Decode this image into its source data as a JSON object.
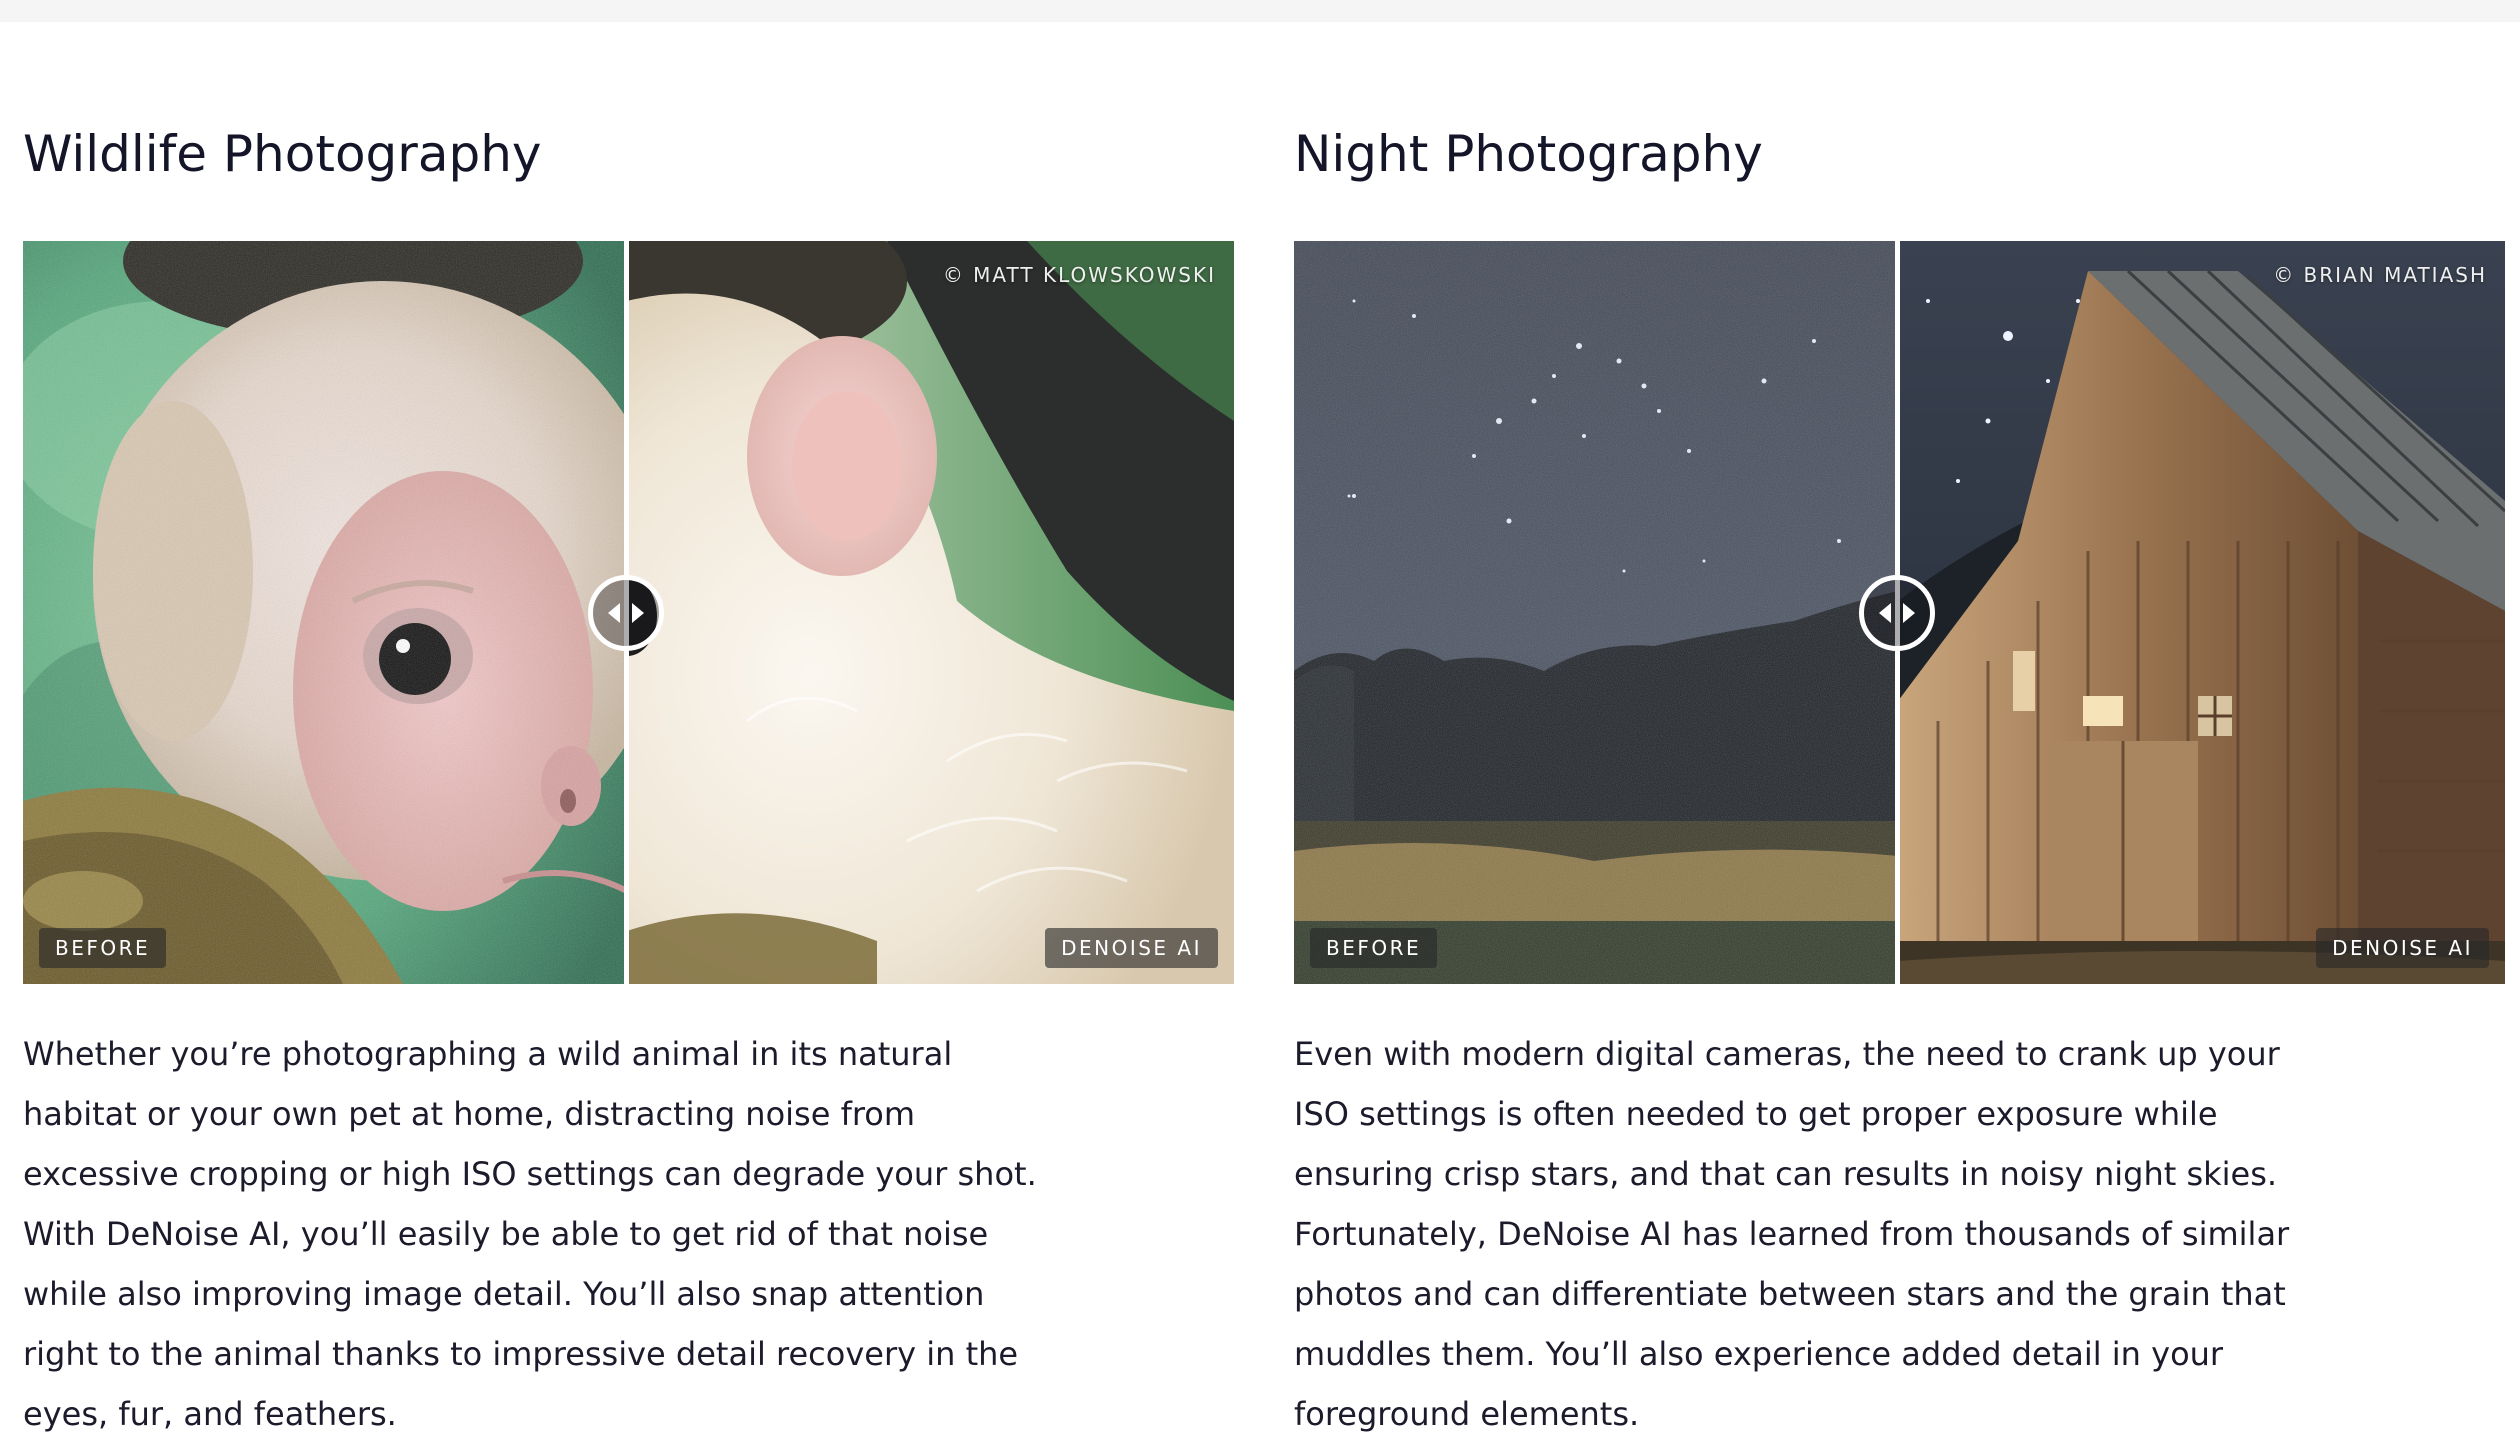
{
  "sections": [
    {
      "title": "Wildlife Photography",
      "credit": "© MATT KLOWSKOWSKI",
      "before_label": "BEFORE",
      "after_label": "DENOISE AI",
      "description": "Whether you’re photographing a wild animal in its natural habitat or your own pet at home, distracting noise from excessive cropping or high ISO settings can degrade your shot. With DeNoise AI, you’ll easily be able to get rid of that noise while also improving image detail. You’ll also snap attention right to the animal thanks to impressive detail recovery in the eyes, fur, and feathers."
    },
    {
      "title": "Night Photography",
      "credit": "© BRIAN MATIASH",
      "before_label": "BEFORE",
      "after_label": "DENOISE AI",
      "description": "Even with modern digital cameras, the need to crank up your ISO settings is often needed to get proper exposure while ensuring crisp stars, and that can results in noisy night skies. Fortunately, DeNoise AI has learned from thousands of similar photos and can differentiate between stars and the grain that muddles them. You’ll also experience added detail in your foreground elements."
    }
  ],
  "icons": {
    "slider_handle": "left-right-arrows-icon"
  },
  "colors": {
    "heading": "#15152a",
    "body_text": "#1b1b2b",
    "divider": "#ffffff",
    "label_bg": "#3a3a3a"
  }
}
